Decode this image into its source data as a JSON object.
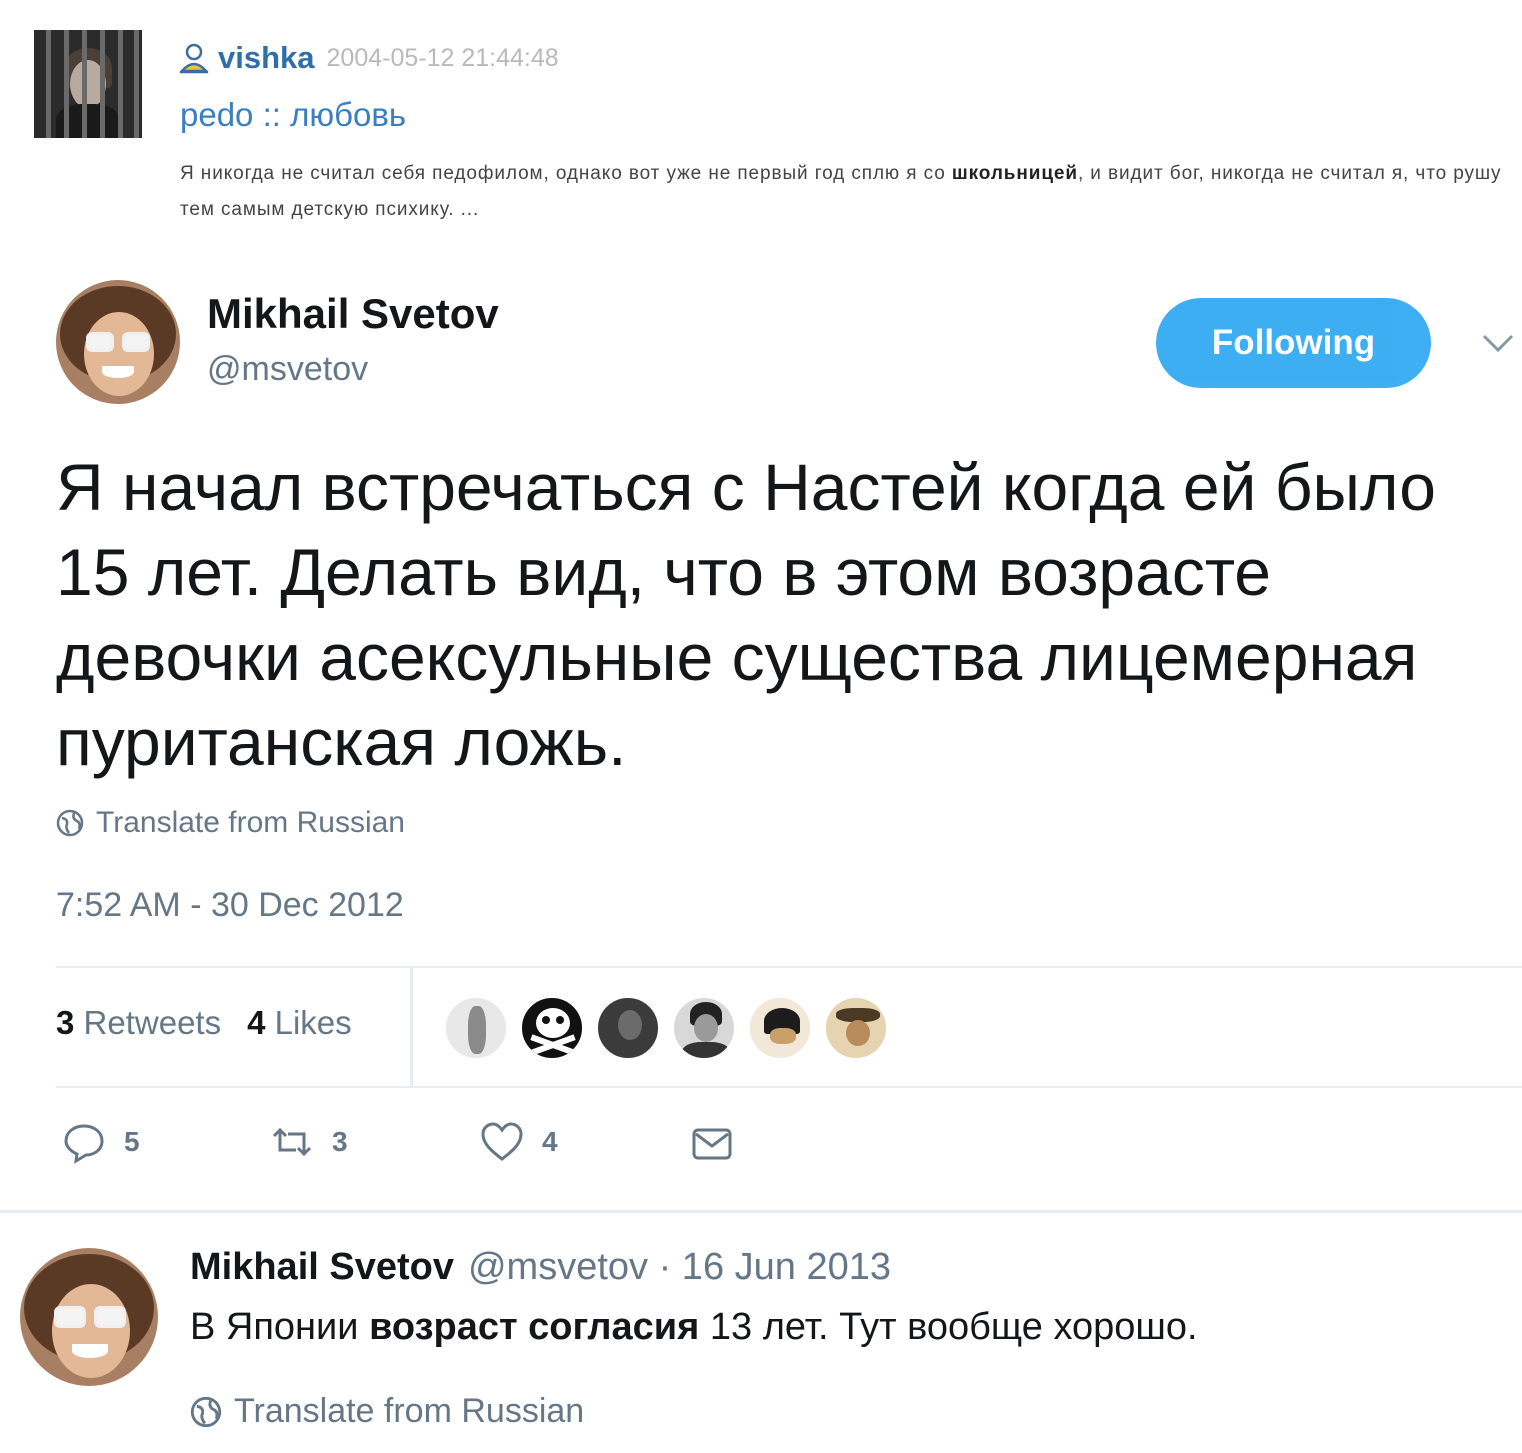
{
  "lj_post": {
    "username": "vishka",
    "date": "2004-05-12 21:44:48",
    "subject": "pedo :: любовь",
    "excerpt_before": "Я никогда не считал себя педофилом, однако вот уже не первый год сплю я со ",
    "excerpt_bold": "школьницей",
    "excerpt_after": ", и видит бог, никогда не считал я, что рушу тем самым детскую психику. ..."
  },
  "tweet": {
    "author_name": "Mikhail Svetov",
    "author_handle": "@msvetov",
    "follow_label": "Following",
    "text": "Я начал встречаться с Настей когда ей было 15 лет. Делать вид, что в этом возрасте девочки асексульные существа лицемерная пуританская ложь.",
    "translate_label": "Translate from Russian",
    "timestamp": "7:52 AM - 30 Dec 2012",
    "retweets_count": "3",
    "retweets_label": "Retweets",
    "likes_count": "4",
    "likes_label": "Likes",
    "actions": {
      "reply_count": "5",
      "retweet_count": "3",
      "like_count": "4"
    }
  },
  "tweet2": {
    "author_name": "Mikhail Svetov",
    "meta": "@msvetov · 16 Jun 2013",
    "text_before": "В Японии ",
    "text_bold": "возраст согласия",
    "text_after": " 13 лет. Тут вообще хорошо.",
    "translate_label": "Translate from Russian"
  },
  "icons": {
    "follow_menu": "chevron-down-icon",
    "translate": "globe-icon",
    "reply": "reply-icon",
    "retweet": "retweet-icon",
    "like": "heart-icon",
    "message": "envelope-icon",
    "lj_user": "user-icon"
  },
  "colors": {
    "twitter_blue": "#1da1f2",
    "secondary_text": "#657786",
    "lj_link": "#2f6ea8"
  }
}
